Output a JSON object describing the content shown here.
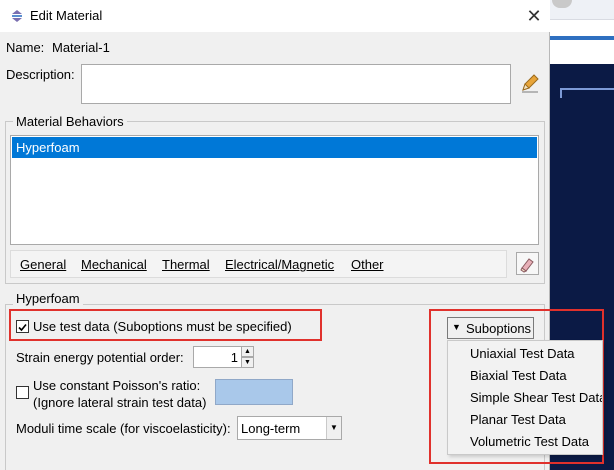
{
  "window": {
    "title": "Edit Material"
  },
  "name": {
    "label": "Name:",
    "value": "Material-1"
  },
  "description": {
    "label": "Description:",
    "value": ""
  },
  "behaviors": {
    "group_title": "Material Behaviors",
    "items": [
      "Hyperfoam"
    ]
  },
  "menu": {
    "items": [
      {
        "label": "General"
      },
      {
        "label": "Mechanical"
      },
      {
        "label": "Thermal"
      },
      {
        "label": "Electrical/Magnetic"
      },
      {
        "label": "Other"
      }
    ]
  },
  "hyperfoam": {
    "group_title": "Hyperfoam",
    "use_test_data": {
      "label": "Use test data (Suboptions must be specified)",
      "checked": true
    },
    "strain_order": {
      "label": "Strain energy potential order:",
      "value": "1"
    },
    "poisson": {
      "label_line1": "Use constant Poisson's ratio:",
      "label_line2": "(Ignore lateral strain test data)",
      "checked": false,
      "field_value": ""
    },
    "moduli": {
      "label": "Moduli time scale (for viscoelasticity):",
      "value": "Long-term"
    }
  },
  "suboptions": {
    "label": "Suboptions",
    "items": [
      "Uniaxial Test Data",
      "Biaxial Test Data",
      "Simple Shear Test Data",
      "Planar Test Data",
      "Volumetric Test Data"
    ]
  },
  "colors": {
    "selection": "#0078d7",
    "highlight_box": "#e0312c",
    "viewport_bg": "#0b1a45"
  }
}
